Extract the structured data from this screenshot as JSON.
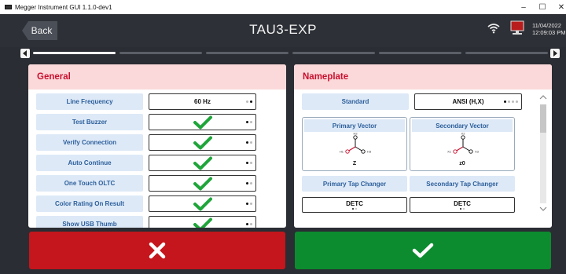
{
  "window": {
    "title": "Megger Instrument GUI 1.1.0-dev1",
    "minimize_label": "–",
    "maximize_label": "☐",
    "close_label": "✕"
  },
  "header": {
    "back_label": "Back",
    "title": "TAU3-EXP",
    "date": "11/04/2022",
    "time": "12:09:03 PM"
  },
  "progress": {
    "segments_total": 6,
    "active_index": 0
  },
  "general": {
    "title": "General",
    "rows": [
      {
        "label": "Line Frequency",
        "value": "60 Hz",
        "type": "text"
      },
      {
        "label": "Test Buzzer",
        "value": "",
        "type": "check"
      },
      {
        "label": "Verify Connection",
        "value": "",
        "type": "check"
      },
      {
        "label": "Auto Continue",
        "value": "",
        "type": "check"
      },
      {
        "label": "One Touch OLTC",
        "value": "",
        "type": "check"
      },
      {
        "label": "Color Rating On Result",
        "value": "",
        "type": "check"
      },
      {
        "label": "Show USB Thumb",
        "value": "",
        "type": "check"
      }
    ]
  },
  "nameplate": {
    "title": "Nameplate",
    "standard_label": "Standard",
    "standard_value": "ANSI (H,X)",
    "primary_vector_label": "Primary Vector",
    "primary_vector_value": "Z",
    "primary_terminals": [
      "H2",
      "H1",
      "H3"
    ],
    "secondary_vector_label": "Secondary Vector",
    "secondary_vector_value": "z0",
    "secondary_terminals": [
      "X2",
      "X1",
      "X3"
    ],
    "primary_tap_label": "Primary Tap Changer",
    "secondary_tap_label": "Secondary Tap Changer",
    "primary_tap_value": "DETC",
    "secondary_tap_value": "DETC"
  },
  "colors": {
    "accent_red": "#c8102e",
    "panel_header_bg": "#fbd9da",
    "label_bg": "#dde9f7",
    "check_green": "#1fa53a",
    "cancel_bg": "#c4161c",
    "ok_bg": "#0c8c2f"
  },
  "icons": {
    "cancel": "x-icon",
    "confirm": "checkmark-icon",
    "wifi": "wifi-icon",
    "monitor": "monitor-icon"
  }
}
